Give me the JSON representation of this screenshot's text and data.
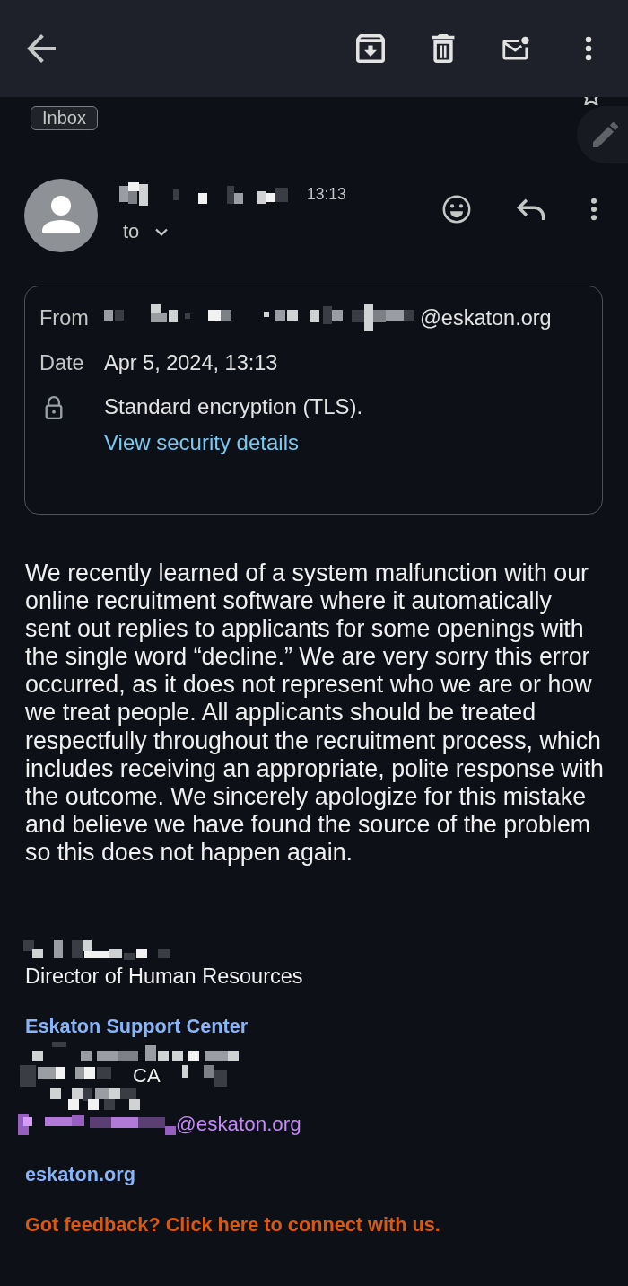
{
  "label_chip": "Inbox",
  "message": {
    "time": "13:13",
    "recipient_label": "to"
  },
  "details": {
    "rows": [
      {
        "kind": "field",
        "label": "From",
        "value": "@eskaton.org",
        "redacted": true
      },
      {
        "kind": "field",
        "label": "Date",
        "value": "Apr 5, 2024, 13:13",
        "redacted": false
      },
      {
        "kind": "security",
        "value": "Standard encryption (TLS).",
        "link": "View security details"
      }
    ]
  },
  "body": {
    "paragraph_lines": [
      "We recently learned of a system malfunction with our",
      "online recruitment software where it automatically",
      "sent out replies to applicants for some openings with",
      "the single word “decline.” We are very sorry this error",
      "occurred, as it does not represent who we are or how",
      "we treat people. All applicants should be treated",
      "respectfully throughout the recruitment process, which",
      "includes receiving an appropriate, polite response with",
      "the outcome. We sincerely apologize for this mistake",
      "and believe we have found the source of the problem",
      "so this does not happen again."
    ]
  },
  "signature": {
    "title": "Director of Human Resources",
    "organization": "Eskaton Support Center",
    "address_fragment": "CA",
    "email": "@eskaton.org",
    "website": "eskaton.org",
    "feedback_link": "Got feedback? Click here to connect with us."
  }
}
